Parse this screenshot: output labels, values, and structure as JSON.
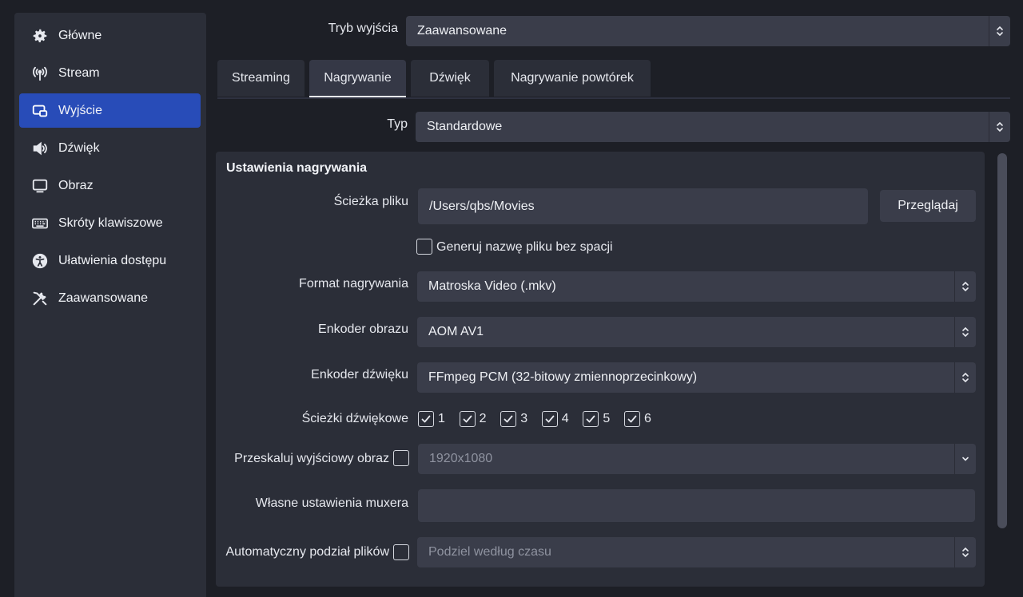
{
  "sidebar": {
    "items": [
      {
        "label": "Główne",
        "icon": "gear-icon"
      },
      {
        "label": "Stream",
        "icon": "antenna-icon"
      },
      {
        "label": "Wyjście",
        "icon": "output-icon",
        "active": true
      },
      {
        "label": "Dźwięk",
        "icon": "speaker-icon"
      },
      {
        "label": "Obraz",
        "icon": "monitor-icon"
      },
      {
        "label": "Skróty klawiszowe",
        "icon": "keyboard-icon"
      },
      {
        "label": "Ułatwienia dostępu",
        "icon": "accessibility-icon"
      },
      {
        "label": "Zaawansowane",
        "icon": "tools-icon"
      }
    ]
  },
  "output_mode": {
    "label": "Tryb wyjścia",
    "value": "Zaawansowane"
  },
  "tabs": [
    {
      "label": "Streaming"
    },
    {
      "label": "Nagrywanie",
      "active": true
    },
    {
      "label": "Dźwięk"
    },
    {
      "label": "Nagrywanie powtórek"
    }
  ],
  "type": {
    "label": "Typ",
    "value": "Standardowe"
  },
  "recording": {
    "title": "Ustawienia nagrywania",
    "path_label": "Ścieżka pliku",
    "path_value": "/Users/qbs/Movies",
    "browse_label": "Przeglądaj",
    "no_space_label": "Generuj nazwę pliku bez spacji",
    "format_label": "Format nagrywania",
    "format_value": "Matroska Video (.mkv)",
    "video_encoder_label": "Enkoder obrazu",
    "video_encoder_value": "AOM AV1",
    "audio_encoder_label": "Enkoder dźwięku",
    "audio_encoder_value": "FFmpeg PCM (32-bitowy zmiennoprzecinkowy)",
    "tracks_label": "Ścieżki dźwiękowe",
    "tracks": [
      "1",
      "2",
      "3",
      "4",
      "5",
      "6"
    ],
    "rescale_label": "Przeskaluj wyjściowy obraz",
    "rescale_value": "1920x1080",
    "muxer_label": "Własne ustawienia muxera",
    "split_label": "Automatyczny podział plików",
    "split_value": "Podziel według czasu"
  },
  "colors": {
    "accent": "#284cb8",
    "background": "#1d1f26",
    "panel": "#2b2e38",
    "field": "#3a3d4a"
  }
}
